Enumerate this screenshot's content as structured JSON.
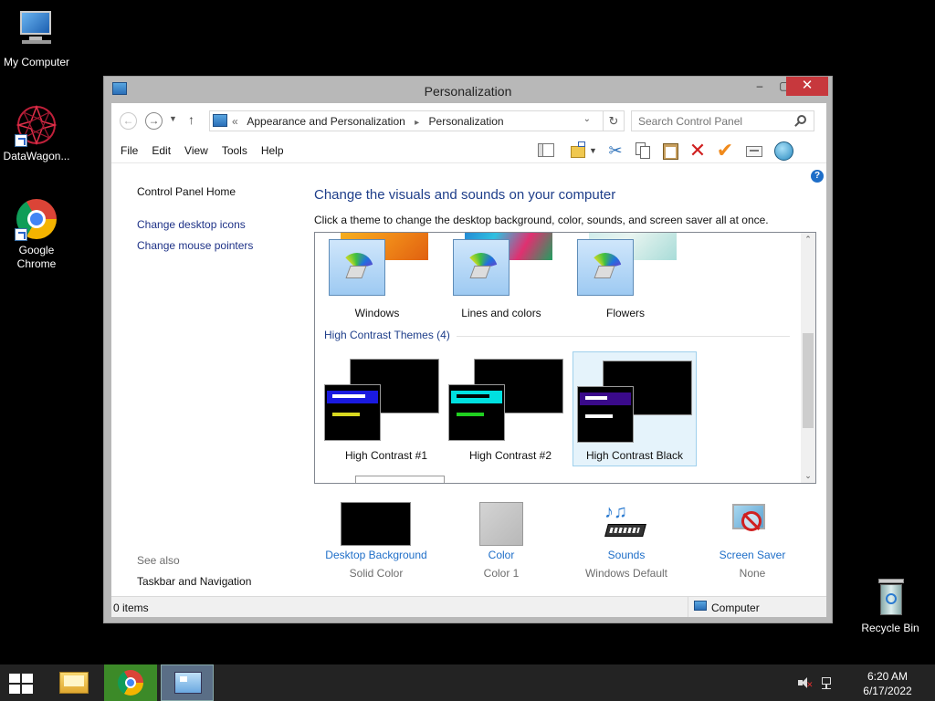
{
  "desktop": {
    "icons": [
      {
        "label": "My Computer"
      },
      {
        "label": "DataWagon..."
      },
      {
        "label": "Google Chrome"
      },
      {
        "label": "Recycle Bin"
      }
    ]
  },
  "window": {
    "title": "Personalization",
    "close_glyph": "✕",
    "max_glyph": "▢",
    "min_glyph": "–"
  },
  "address": {
    "prefix": "«",
    "crumbs": [
      "Appearance and Personalization",
      "Personalization"
    ],
    "search_placeholder": "Search Control Panel"
  },
  "menu": [
    "File",
    "Edit",
    "View",
    "Tools",
    "Help"
  ],
  "left_pane": {
    "home": "Control Panel Home",
    "links": [
      "Change desktop icons",
      "Change mouse pointers"
    ],
    "see_also": "See also",
    "see_also_links": [
      "Taskbar and Navigation"
    ]
  },
  "main": {
    "heading": "Change the visuals and sounds on your computer",
    "subtext": "Click a theme to change the desktop background, color, sounds, and screen saver all at once.",
    "themes": [
      {
        "label": "Windows"
      },
      {
        "label": "Lines and colors"
      },
      {
        "label": "Flowers"
      }
    ],
    "hc_section": "High Contrast Themes (4)",
    "hc_themes": [
      {
        "label": "High Contrast #1",
        "bar_color": "#1a1ae0",
        "line_color": "#d8d820"
      },
      {
        "label": "High Contrast #2",
        "bar_color": "#00e0e0",
        "line_color": "#20d020"
      },
      {
        "label": "High Contrast Black",
        "bar_color": "#3a0a8a",
        "line_color": "#ffffff"
      }
    ],
    "selected_theme": "High Contrast Black"
  },
  "settings": [
    {
      "link": "Desktop Background",
      "value": "Solid Color"
    },
    {
      "link": "Color",
      "value": "Color 1"
    },
    {
      "link": "Sounds",
      "value": "Windows Default"
    },
    {
      "link": "Screen Saver",
      "value": "None"
    }
  ],
  "status": {
    "items": "0 items",
    "location": "Computer"
  },
  "clock": {
    "time": "6:20 AM",
    "date": "6/17/2022"
  }
}
